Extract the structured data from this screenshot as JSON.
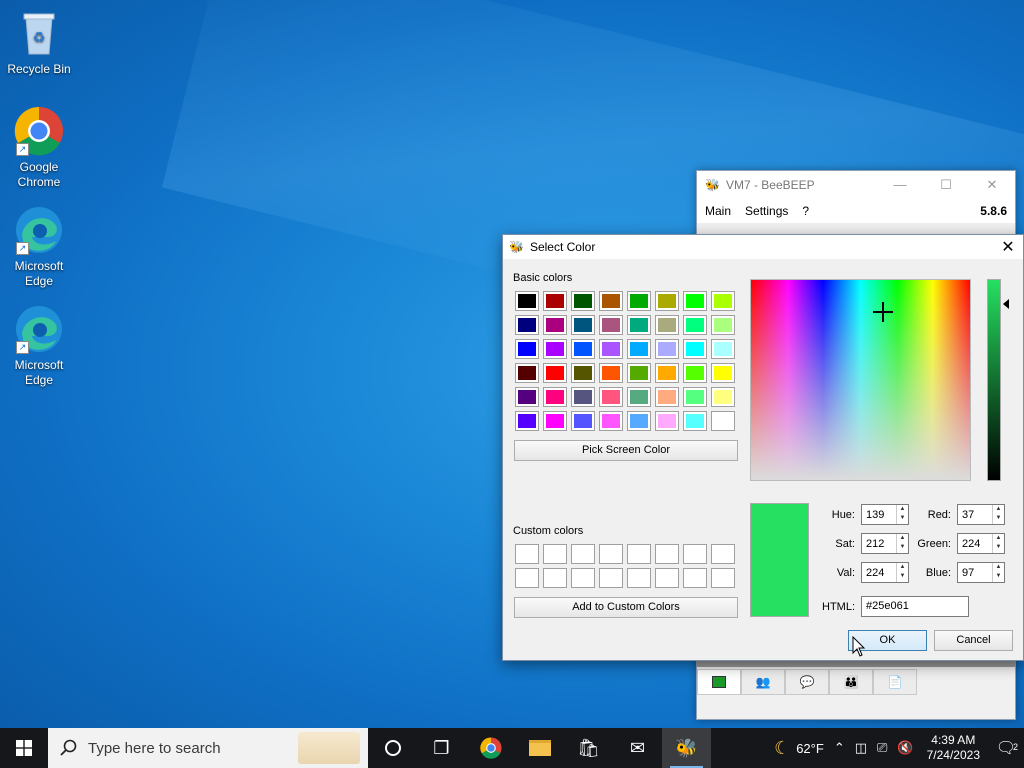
{
  "desktop": {
    "icons": [
      {
        "label": "Recycle Bin"
      },
      {
        "label": "Google Chrome"
      },
      {
        "label": "Microsoft Edge"
      },
      {
        "label": "Microsoft Edge"
      }
    ]
  },
  "beebeep": {
    "title": "VM7 - BeeBEEP",
    "menu": [
      "Main",
      "Settings",
      "?"
    ],
    "version": "5.8.6"
  },
  "dialog": {
    "title": "Select Color",
    "basic_colors_label": "Basic colors",
    "custom_colors_label": "Custom colors",
    "pick_screen_color": "Pick Screen Color",
    "add_custom_colors": "Add to Custom Colors",
    "basic_colors": [
      "#000000",
      "#aa0000",
      "#005500",
      "#aa5500",
      "#00aa00",
      "#aaaa00",
      "#00ff00",
      "#aaff00",
      "#00007f",
      "#aa007f",
      "#00557f",
      "#aa557f",
      "#00aa7f",
      "#aaaa7f",
      "#00ff7f",
      "#aaff7f",
      "#0000ff",
      "#aa00ff",
      "#0055ff",
      "#aa55ff",
      "#00aaff",
      "#aaaaff",
      "#00ffff",
      "#aaffff",
      "#550000",
      "#ff0000",
      "#555500",
      "#ff5500",
      "#55aa00",
      "#ffaa00",
      "#55ff00",
      "#ffff00",
      "#55007f",
      "#ff007f",
      "#55557f",
      "#ff557f",
      "#55aa7f",
      "#ffaa7f",
      "#55ff7f",
      "#ffff7f",
      "#5500ff",
      "#ff00ff",
      "#5555ff",
      "#ff55ff",
      "#55aaff",
      "#ffaaff",
      "#55ffff",
      "#ffffff"
    ],
    "fields": {
      "hue": {
        "label": "Hue:",
        "value": "139"
      },
      "sat": {
        "label": "Sat:",
        "value": "212"
      },
      "val": {
        "label": "Val:",
        "value": "224"
      },
      "red": {
        "label": "Red:",
        "value": "37"
      },
      "green": {
        "label": "Green:",
        "value": "224"
      },
      "blue": {
        "label": "Blue:",
        "value": "97"
      },
      "html": {
        "label": "HTML:",
        "value": "#25e061"
      }
    },
    "current_color": "#25e061",
    "ok": "OK",
    "cancel": "Cancel"
  },
  "taskbar": {
    "search_placeholder": "Type here to search",
    "weather": "62°F",
    "time": "4:39 AM",
    "date": "7/24/2023",
    "notifications": "2"
  }
}
